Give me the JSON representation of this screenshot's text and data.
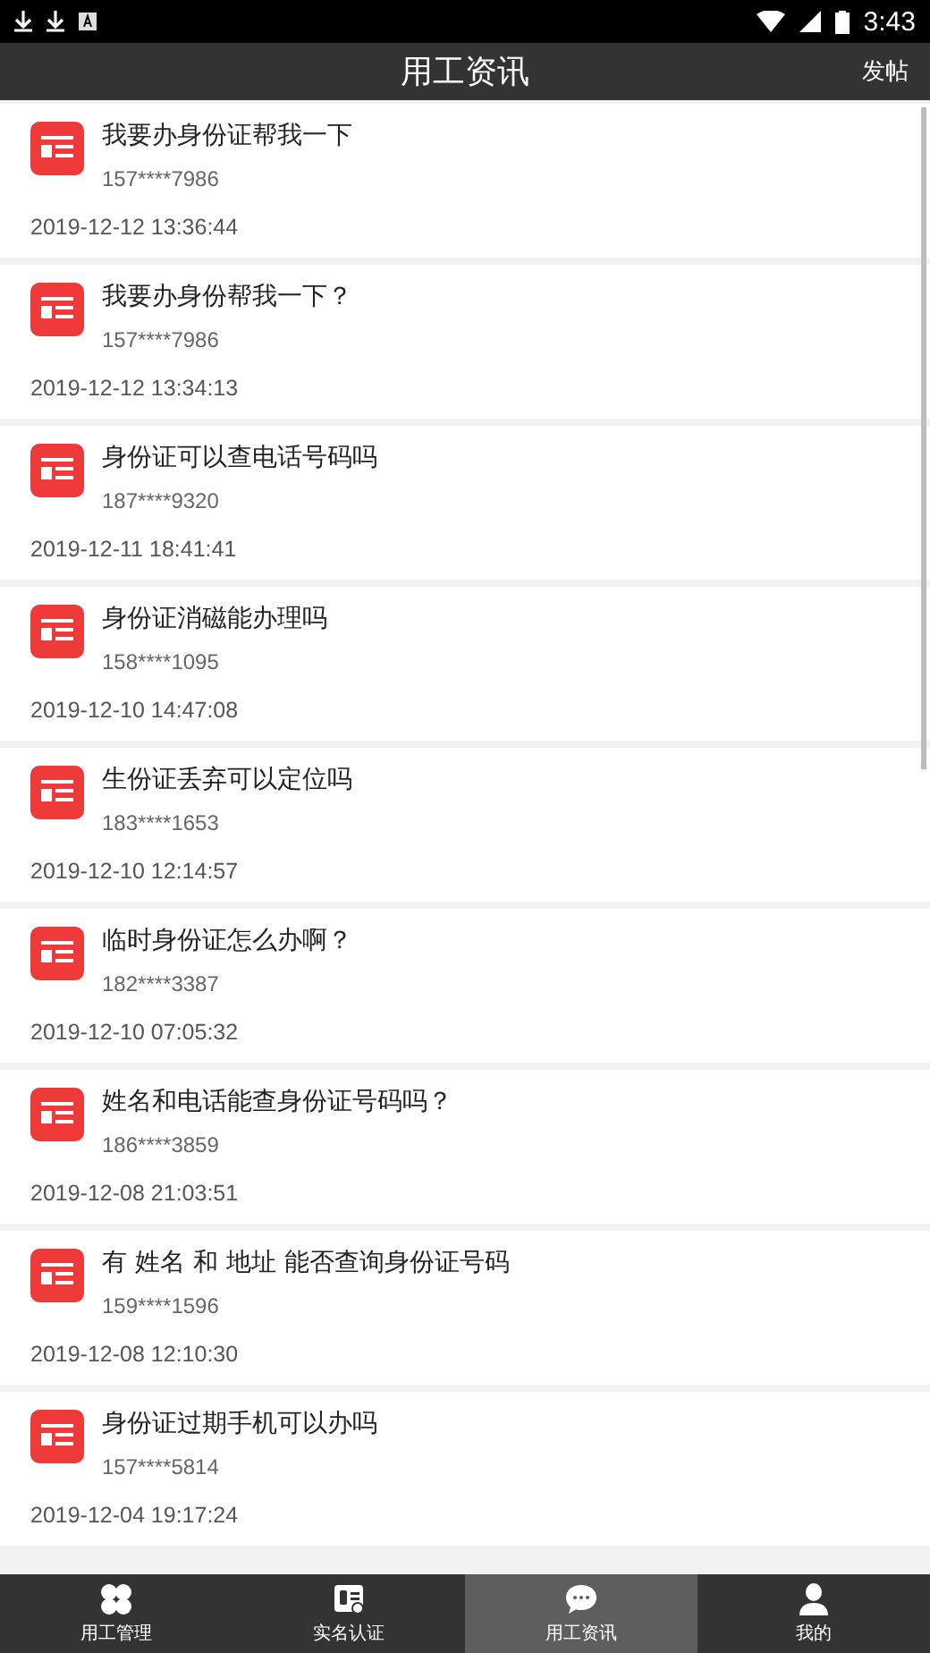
{
  "status_bar": {
    "time": "3:43"
  },
  "header": {
    "title": "用工资讯",
    "action": "发帖"
  },
  "posts": [
    {
      "title": "我要办身份证帮我一下",
      "phone": "157****7986",
      "time": "2019-12-12 13:36:44"
    },
    {
      "title": "我要办身份帮我一下？",
      "phone": "157****7986",
      "time": "2019-12-12 13:34:13"
    },
    {
      "title": "身份证可以查电话号码吗",
      "phone": "187****9320",
      "time": "2019-12-11 18:41:41"
    },
    {
      "title": "身份证消磁能办理吗",
      "phone": "158****1095",
      "time": "2019-12-10 14:47:08"
    },
    {
      "title": "生份证丢弃可以定位吗",
      "phone": "183****1653",
      "time": "2019-12-10 12:14:57"
    },
    {
      "title": "临时身份证怎么办啊？",
      "phone": "182****3387",
      "time": "2019-12-10 07:05:32"
    },
    {
      "title": "姓名和电话能查身份证号码吗？",
      "phone": "186****3859",
      "time": "2019-12-08 21:03:51"
    },
    {
      "title": "有 姓名 和 地址 能否查询身份证号码",
      "phone": "159****1596",
      "time": "2019-12-08 12:10:30"
    },
    {
      "title": "身份证过期手机可以办吗",
      "phone": "157****5814",
      "time": "2019-12-04 19:17:24"
    }
  ],
  "tabs": [
    {
      "kind": "grid",
      "label": "用工管理",
      "selected": false
    },
    {
      "kind": "idcard",
      "label": "实名认证",
      "selected": false
    },
    {
      "kind": "chat",
      "label": "用工资讯",
      "selected": true
    },
    {
      "kind": "person",
      "label": "我的",
      "selected": false
    }
  ]
}
